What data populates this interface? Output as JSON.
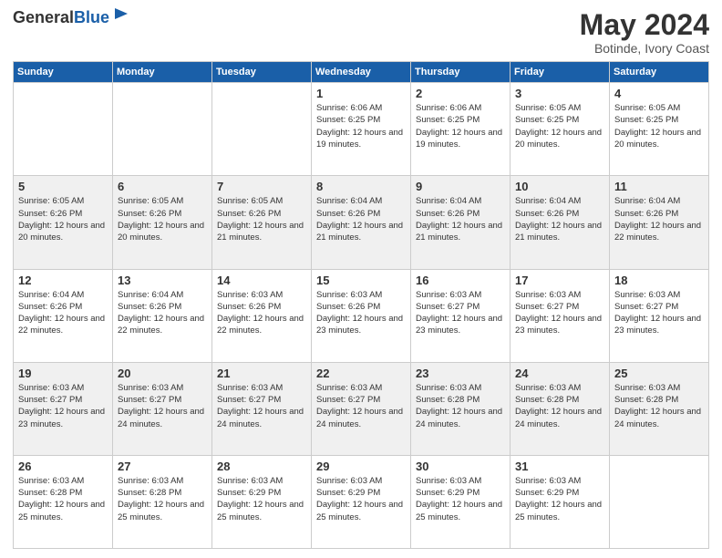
{
  "header": {
    "logo_general": "General",
    "logo_blue": "Blue",
    "month_title": "May 2024",
    "location": "Botinde, Ivory Coast"
  },
  "days_of_week": [
    "Sunday",
    "Monday",
    "Tuesday",
    "Wednesday",
    "Thursday",
    "Friday",
    "Saturday"
  ],
  "weeks": [
    [
      {
        "day": "",
        "empty": true
      },
      {
        "day": "",
        "empty": true
      },
      {
        "day": "",
        "empty": true
      },
      {
        "day": "1",
        "sunrise": "6:06 AM",
        "sunset": "6:25 PM",
        "daylight": "12 hours and 19 minutes."
      },
      {
        "day": "2",
        "sunrise": "6:06 AM",
        "sunset": "6:25 PM",
        "daylight": "12 hours and 19 minutes."
      },
      {
        "day": "3",
        "sunrise": "6:05 AM",
        "sunset": "6:25 PM",
        "daylight": "12 hours and 20 minutes."
      },
      {
        "day": "4",
        "sunrise": "6:05 AM",
        "sunset": "6:25 PM",
        "daylight": "12 hours and 20 minutes."
      }
    ],
    [
      {
        "day": "5",
        "sunrise": "6:05 AM",
        "sunset": "6:26 PM",
        "daylight": "12 hours and 20 minutes."
      },
      {
        "day": "6",
        "sunrise": "6:05 AM",
        "sunset": "6:26 PM",
        "daylight": "12 hours and 20 minutes."
      },
      {
        "day": "7",
        "sunrise": "6:05 AM",
        "sunset": "6:26 PM",
        "daylight": "12 hours and 21 minutes."
      },
      {
        "day": "8",
        "sunrise": "6:04 AM",
        "sunset": "6:26 PM",
        "daylight": "12 hours and 21 minutes."
      },
      {
        "day": "9",
        "sunrise": "6:04 AM",
        "sunset": "6:26 PM",
        "daylight": "12 hours and 21 minutes."
      },
      {
        "day": "10",
        "sunrise": "6:04 AM",
        "sunset": "6:26 PM",
        "daylight": "12 hours and 21 minutes."
      },
      {
        "day": "11",
        "sunrise": "6:04 AM",
        "sunset": "6:26 PM",
        "daylight": "12 hours and 22 minutes."
      }
    ],
    [
      {
        "day": "12",
        "sunrise": "6:04 AM",
        "sunset": "6:26 PM",
        "daylight": "12 hours and 22 minutes."
      },
      {
        "day": "13",
        "sunrise": "6:04 AM",
        "sunset": "6:26 PM",
        "daylight": "12 hours and 22 minutes."
      },
      {
        "day": "14",
        "sunrise": "6:03 AM",
        "sunset": "6:26 PM",
        "daylight": "12 hours and 22 minutes."
      },
      {
        "day": "15",
        "sunrise": "6:03 AM",
        "sunset": "6:26 PM",
        "daylight": "12 hours and 23 minutes."
      },
      {
        "day": "16",
        "sunrise": "6:03 AM",
        "sunset": "6:27 PM",
        "daylight": "12 hours and 23 minutes."
      },
      {
        "day": "17",
        "sunrise": "6:03 AM",
        "sunset": "6:27 PM",
        "daylight": "12 hours and 23 minutes."
      },
      {
        "day": "18",
        "sunrise": "6:03 AM",
        "sunset": "6:27 PM",
        "daylight": "12 hours and 23 minutes."
      }
    ],
    [
      {
        "day": "19",
        "sunrise": "6:03 AM",
        "sunset": "6:27 PM",
        "daylight": "12 hours and 23 minutes."
      },
      {
        "day": "20",
        "sunrise": "6:03 AM",
        "sunset": "6:27 PM",
        "daylight": "12 hours and 24 minutes."
      },
      {
        "day": "21",
        "sunrise": "6:03 AM",
        "sunset": "6:27 PM",
        "daylight": "12 hours and 24 minutes."
      },
      {
        "day": "22",
        "sunrise": "6:03 AM",
        "sunset": "6:27 PM",
        "daylight": "12 hours and 24 minutes."
      },
      {
        "day": "23",
        "sunrise": "6:03 AM",
        "sunset": "6:28 PM",
        "daylight": "12 hours and 24 minutes."
      },
      {
        "day": "24",
        "sunrise": "6:03 AM",
        "sunset": "6:28 PM",
        "daylight": "12 hours and 24 minutes."
      },
      {
        "day": "25",
        "sunrise": "6:03 AM",
        "sunset": "6:28 PM",
        "daylight": "12 hours and 24 minutes."
      }
    ],
    [
      {
        "day": "26",
        "sunrise": "6:03 AM",
        "sunset": "6:28 PM",
        "daylight": "12 hours and 25 minutes."
      },
      {
        "day": "27",
        "sunrise": "6:03 AM",
        "sunset": "6:28 PM",
        "daylight": "12 hours and 25 minutes."
      },
      {
        "day": "28",
        "sunrise": "6:03 AM",
        "sunset": "6:29 PM",
        "daylight": "12 hours and 25 minutes."
      },
      {
        "day": "29",
        "sunrise": "6:03 AM",
        "sunset": "6:29 PM",
        "daylight": "12 hours and 25 minutes."
      },
      {
        "day": "30",
        "sunrise": "6:03 AM",
        "sunset": "6:29 PM",
        "daylight": "12 hours and 25 minutes."
      },
      {
        "day": "31",
        "sunrise": "6:03 AM",
        "sunset": "6:29 PM",
        "daylight": "12 hours and 25 minutes."
      },
      {
        "day": "",
        "empty": true
      }
    ]
  ]
}
